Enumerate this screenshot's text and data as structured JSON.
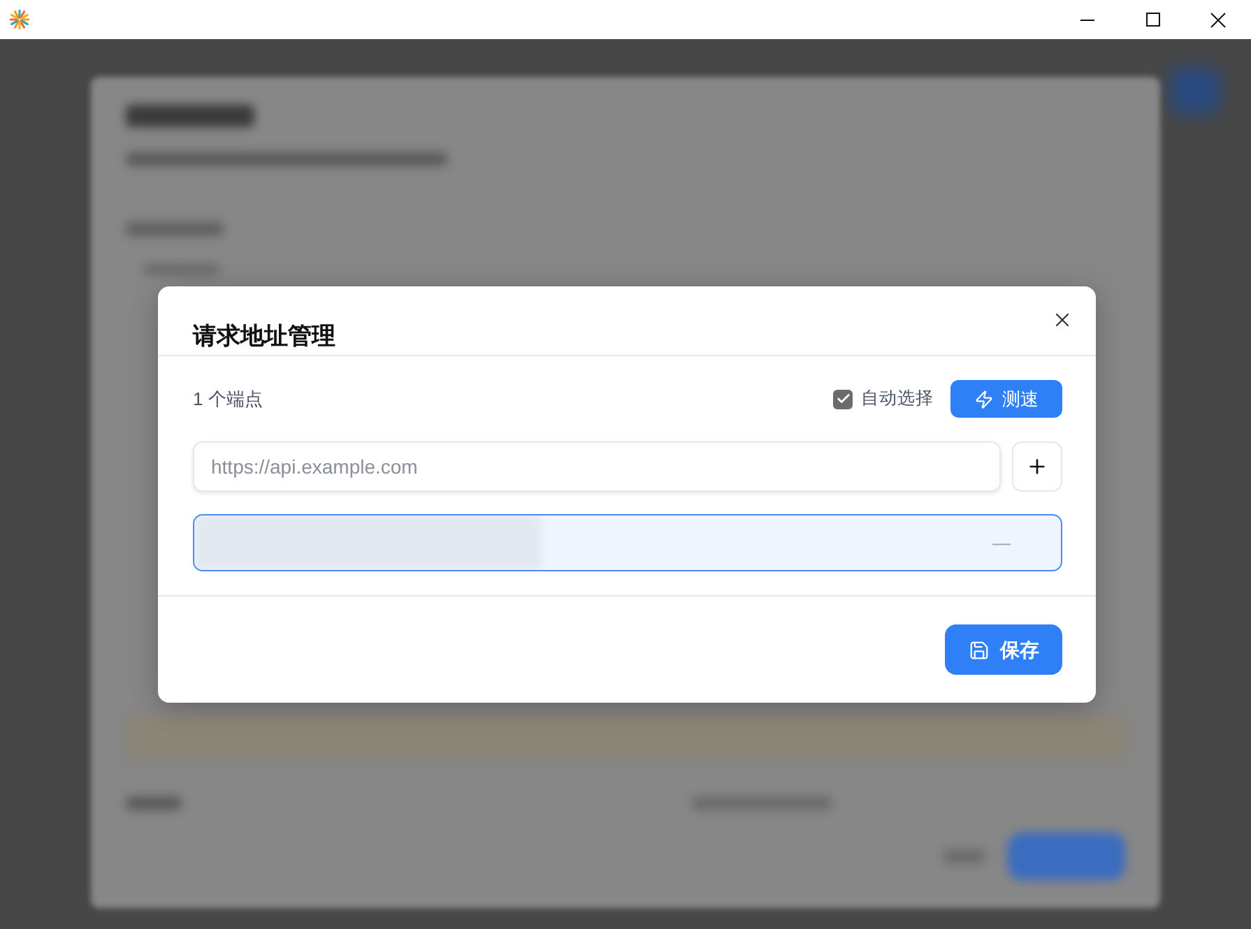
{
  "dialog": {
    "title": "请求地址管理",
    "endpoint_count": "1 个端点",
    "auto_select": {
      "label": "自动选择",
      "checked": true
    },
    "speed_test_button": "测速",
    "url_input": {
      "placeholder": "https://api.example.com"
    },
    "endpoints": [
      {
        "latency": "—",
        "selected": true
      }
    ],
    "save_button": "保存"
  }
}
